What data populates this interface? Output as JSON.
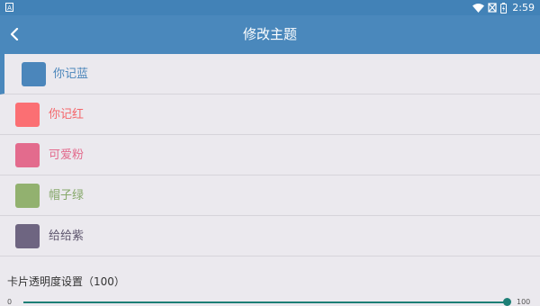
{
  "status_bar": {
    "app_icon_letter": "A",
    "time": "2:59",
    "icons": [
      "wifi-icon",
      "no-sim-icon",
      "battery-icon"
    ]
  },
  "header": {
    "title": "修改主题",
    "back_icon": "chevron-left-icon"
  },
  "themes": [
    {
      "label": "你记蓝",
      "color": "#4b86bb",
      "text_color": "#4b86bb",
      "selected": true
    },
    {
      "label": "你记红",
      "color": "#fb6f73",
      "text_color": "#f4676b",
      "selected": false
    },
    {
      "label": "可爱粉",
      "color": "#e36b8d",
      "text_color": "#e36b8d",
      "selected": false
    },
    {
      "label": "帽子绿",
      "color": "#92b16f",
      "text_color": "#86a86a",
      "selected": false
    },
    {
      "label": "给给紫",
      "color": "#6e6581",
      "text_color": "#5f576f",
      "selected": false
    }
  ],
  "opacity": {
    "label": "卡片透明度设置（100）",
    "min": "0",
    "max": "100",
    "value": 100
  },
  "colors": {
    "primary": "#4a88bc",
    "status_bar": "#4282b7",
    "background": "#ebe9ee",
    "slider": "#1d7f76"
  }
}
